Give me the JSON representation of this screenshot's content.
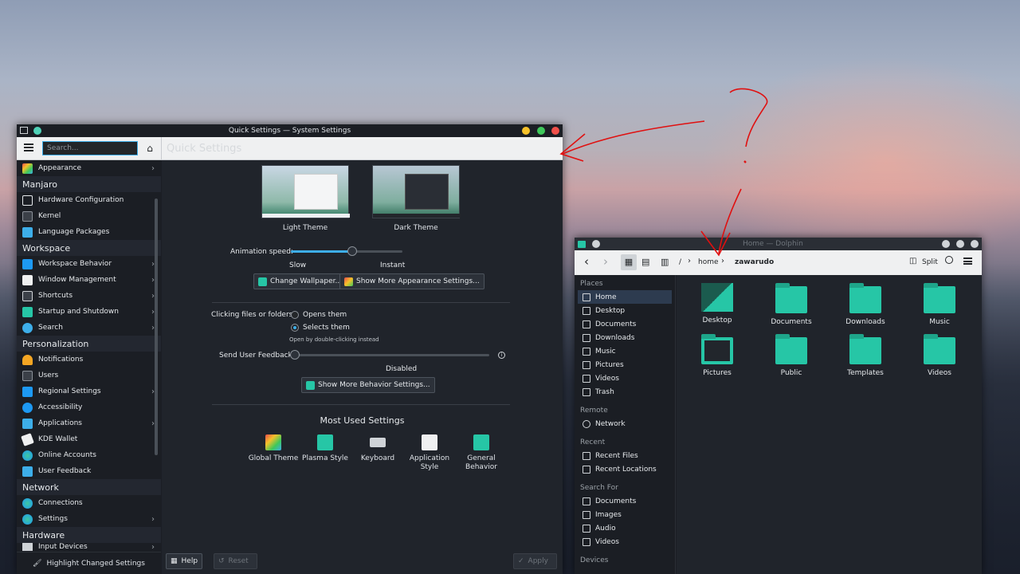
{
  "colors": {
    "accent": "#3daee9",
    "teal": "#26c6a6",
    "annotation": "#e01010"
  },
  "sys": {
    "window_title": "Quick Settings — System Settings",
    "search_placeholder": "Search...",
    "page_title": "Quick Settings",
    "sidebar": {
      "appearance": "Appearance",
      "manjaro": "Manjaro",
      "hardware_configuration": "Hardware Configuration",
      "kernel": "Kernel",
      "language_packages": "Language Packages",
      "workspace": "Workspace",
      "workspace_behavior": "Workspace Behavior",
      "window_management": "Window Management",
      "shortcuts": "Shortcuts",
      "startup_shutdown": "Startup and Shutdown",
      "search": "Search",
      "personalization": "Personalization",
      "notifications": "Notifications",
      "users": "Users",
      "regional_settings": "Regional Settings",
      "accessibility": "Accessibility",
      "applications": "Applications",
      "kde_wallet": "KDE Wallet",
      "online_accounts": "Online Accounts",
      "user_feedback": "User Feedback",
      "network": "Network",
      "connections": "Connections",
      "settings": "Settings",
      "hardware": "Hardware",
      "input_devices": "Input Devices"
    },
    "highlight": "Highlight Changed Settings",
    "light_theme": "Light Theme",
    "dark_theme": "Dark Theme",
    "animation_speed": "Animation speed:",
    "slow": "Slow",
    "instant": "Instant",
    "animation_value": 0.55,
    "change_wallpaper": "Change Wallpaper...",
    "more_appearance": "Show More Appearance Settings...",
    "clicking_label": "Clicking files or folders:",
    "opens_them": "Opens them",
    "selects_them": "Selects them",
    "open_hint": "Open by double-clicking instead",
    "feedback_label": "Send User Feedback:",
    "feedback_value": "Disabled",
    "more_behavior": "Show More Behavior Settings...",
    "most_used": "Most Used Settings",
    "mu": {
      "global_theme": "Global Theme",
      "plasma_style": "Plasma Style",
      "keyboard": "Keyboard",
      "app_style_1": "Application",
      "app_style_2": "Style",
      "general_1": "General",
      "general_2": "Behavior"
    },
    "help": "Help",
    "reset": "Reset",
    "apply": "Apply"
  },
  "dolphin": {
    "window_title": "Home — Dolphin",
    "path_root": "/",
    "path_home": "home",
    "path_user": "zawarudo",
    "split": "Split",
    "places_head": "Places",
    "places": {
      "home": "Home",
      "desktop": "Desktop",
      "documents": "Documents",
      "downloads": "Downloads",
      "music": "Music",
      "pictures": "Pictures",
      "videos": "Videos",
      "trash": "Trash"
    },
    "remote_head": "Remote",
    "network": "Network",
    "recent_head": "Recent",
    "recent_files": "Recent Files",
    "recent_locations": "Recent Locations",
    "search_head": "Search For",
    "s_documents": "Documents",
    "s_images": "Images",
    "s_audio": "Audio",
    "s_videos": "Videos",
    "devices_head": "Devices",
    "folders": {
      "desktop": "Desktop",
      "documents": "Documents",
      "downloads": "Downloads",
      "music": "Music",
      "pictures": "Pictures",
      "public": "Public",
      "templates": "Templates",
      "videos": "Videos"
    }
  }
}
